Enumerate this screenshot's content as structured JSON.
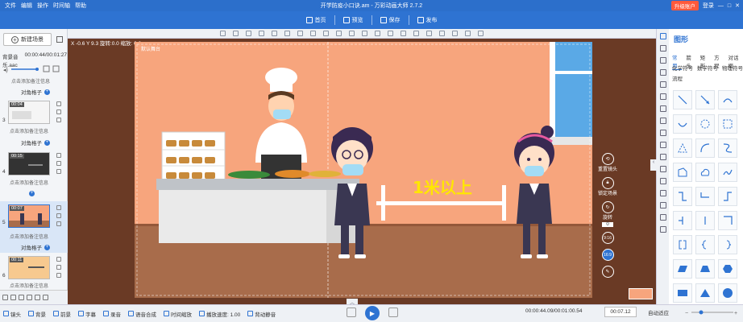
{
  "app": {
    "title": "开学防疫小口诀.am - 万彩动画大师 2.7.2",
    "menu": [
      "文件",
      "编辑",
      "操作",
      "时间轴",
      "帮助"
    ],
    "upgrade": "升级账户",
    "login": "登录"
  },
  "toolbar": {
    "items": [
      "首页",
      "预览",
      "保存",
      "发布"
    ]
  },
  "left": {
    "new_scene": "新建场景",
    "bg_music_label": "背景音乐.aac",
    "bg_music_time": "00:00:44/00:01:27",
    "note": "点击添加备注信息",
    "scenes": [
      {
        "num": "3",
        "time": "00:04",
        "transition": "对角格子"
      },
      {
        "num": "4",
        "time": "00:15",
        "transition": "模糊转场"
      },
      {
        "num": "5",
        "time": "00:07",
        "transition": "对角格子"
      },
      {
        "num": "6",
        "time": "00:11",
        "transition": ""
      }
    ],
    "top_transition": "对角格子"
  },
  "canvas": {
    "coords": "X -0.6 Y 9.3 旋转:0.0 缩放: 0.9",
    "stage_label": "默认舞台",
    "sign_text": "1米以上",
    "colors": {
      "wall": "#f7a57d",
      "floor": "#a86c4b",
      "frame": "#6a3a25",
      "sign": "#ffe600"
    }
  },
  "right_tools": {
    "lens": "重置镜头",
    "lock": "锁定场景",
    "rotate": "旋转",
    "rotate_value": "0",
    "ratio1": "9:16",
    "ratio2": "16:9"
  },
  "shapes": {
    "title": "图形",
    "cats1": [
      "常用",
      "箭头",
      "矩形",
      "方程",
      "对话框"
    ],
    "cats2": [
      "化学符号",
      "数学符号",
      "物理符号"
    ],
    "cats3": [
      "流程"
    ]
  },
  "bottom": {
    "items": [
      "镜头",
      "背景",
      "前景",
      "字幕",
      "录音",
      "语音合成",
      "时间缩放",
      "播放速度: 1.00",
      "背动静音"
    ],
    "time": "00:00:44.09/00:01:00.54",
    "current": "00:07.12",
    "auto": "自动适应"
  }
}
